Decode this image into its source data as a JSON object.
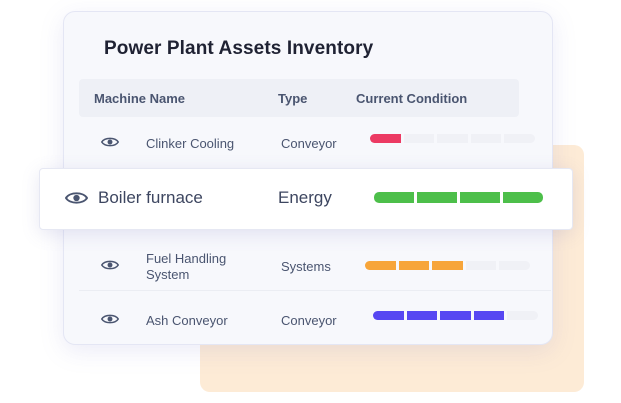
{
  "colors": {
    "accent_background": "#fdebd6",
    "bar_empty": "#f0f1f6",
    "red": "#ec3a63",
    "green": "#4dbf4a",
    "orange": "#f7a53a",
    "purple": "#5747f2"
  },
  "title": "Power Plant Assets Inventory",
  "headers": {
    "machine_name": "Machine Name",
    "type": "Type",
    "current_condition": "Current Condition"
  },
  "rows": [
    {
      "name": "Clinker Cooling",
      "type": "Conveyor",
      "icon": "eye-icon",
      "condition_segments": 1,
      "total_segments": 5,
      "color": "#ec3a63"
    },
    {
      "name": "Boiler furnace",
      "type": "Energy",
      "icon": "eye-icon",
      "condition_segments": 4,
      "total_segments": 4,
      "color": "#4dbf4a"
    },
    {
      "name": "Fuel Handling System",
      "name_line1": "Fuel Handling",
      "name_line2": "System",
      "type": "Systems",
      "icon": "eye-icon",
      "condition_segments": 3,
      "total_segments": 5,
      "color": "#f7a53a"
    },
    {
      "name": "Ash Conveyor",
      "type": "Conveyor",
      "icon": "eye-icon",
      "condition_segments": 4,
      "total_segments": 5,
      "color": "#5747f2"
    }
  ]
}
